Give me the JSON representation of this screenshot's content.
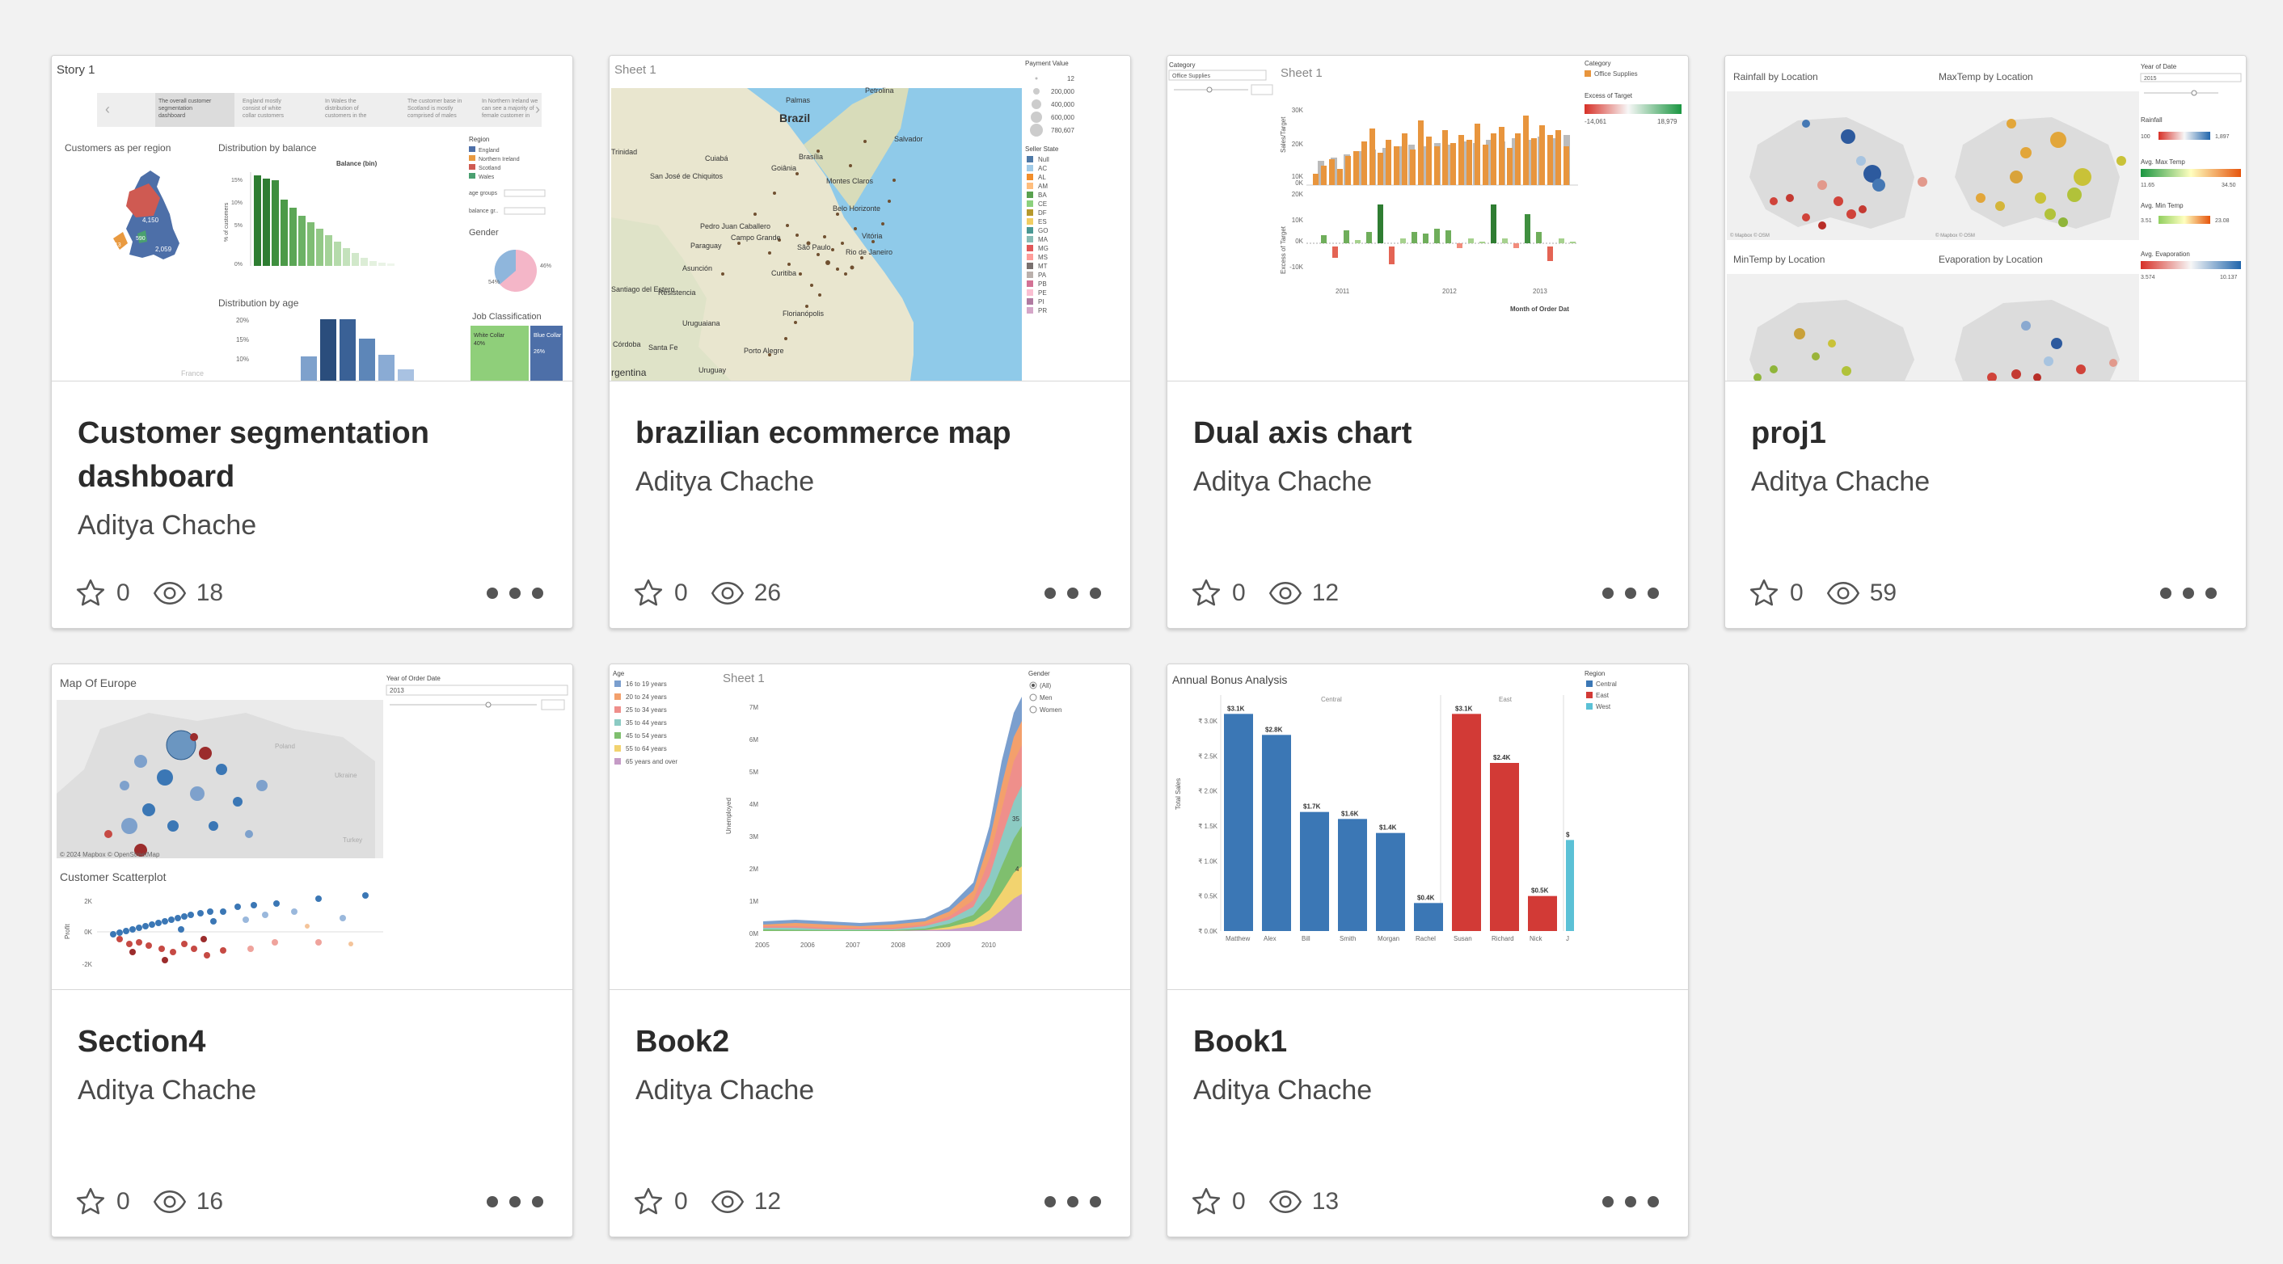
{
  "cards": [
    {
      "title": "Customer segmentation dashboard",
      "author": "Aditya Chache",
      "favorites": "0",
      "views": "18",
      "thumb": {
        "tab": "Story 1",
        "story_points": [
          "The overall customer segmentation dashboard",
          "England mostly consist of white collar customers",
          "In Wales the distribution of customers in the",
          "The customer base in Scotland is mostly comprised of males",
          "In Northern Ireland we can see a majority of female customer in"
        ],
        "panel1": "Customers as per region",
        "panel2": "Distribution by balance",
        "chart_title": "Balance (bin)",
        "panel3": "Distribution by age",
        "legend_title": "Region",
        "legend": [
          "England",
          "Northern Ireland",
          "Scotland",
          "Wales"
        ],
        "filter1": "age groups",
        "filter2": "balance gr..",
        "gender": "Gender",
        "job": "Job Classification",
        "white": "White Collar",
        "white_pct": "40%",
        "blue": "Blue Collar",
        "blue_pct": "26%",
        "france": "France",
        "pie_left": "54%",
        "pie_right": "46%",
        "ylab": "% of customers",
        "map_labels": [
          "4,150",
          "2,059",
          "413",
          "590"
        ],
        "y_ticks": [
          "15%",
          "10%",
          "5%",
          "0%"
        ],
        "age_ticks": [
          "20%",
          "15%",
          "10%"
        ]
      }
    },
    {
      "title": "brazilian ecommerce map",
      "author": "Aditya Chache",
      "favorites": "0",
      "views": "26",
      "thumb": {
        "sheet": "Sheet 1",
        "pay_title": "Payment Value",
        "pay": [
          "12",
          "200,000",
          "400,000",
          "600,000",
          "780,607"
        ],
        "state_title": "Seller State",
        "states": [
          "Null",
          "AC",
          "AL",
          "AM",
          "BA",
          "CE",
          "DF",
          "ES",
          "GO",
          "MA",
          "MG",
          "MS",
          "MT",
          "PA",
          "PB",
          "PE",
          "PI",
          "PR"
        ],
        "places": [
          "Brazil",
          "Palmas",
          "Petrolina",
          "Salvador",
          "Cuiabá",
          "Goiânia",
          "Brasília",
          "Montes Claros",
          "Belo Horizonte",
          "Pedro Juan Caballero",
          "Paraguay",
          "Asunción",
          "Curitiba",
          "Resistencia",
          "Santiago del Estero",
          "Uruguaiana",
          "Porto Alegre",
          "Córdoba",
          "Santa Fe",
          "Uruguay",
          "rgentina",
          "Trinidad",
          "San José de Chiquitos",
          "Campo Grande",
          "São Paulo",
          "Rio de Janeiro",
          "Florianópolis",
          "Vitória"
        ]
      }
    },
    {
      "title": "Dual axis chart",
      "author": "Aditya Chache",
      "favorites": "0",
      "views": "12",
      "thumb": {
        "sheet": "Sheet 1",
        "filter_title": "Category",
        "filter_value": "Office Supplies",
        "legend_title": "Category",
        "legend_item": "Office Supplies",
        "excess_title": "Excess of Target",
        "excess_min": "-14,061",
        "excess_max": "18,979",
        "y1": "Sales/Target",
        "y2": "Excess of Target",
        "x_title": "Month of Order Dat",
        "years": [
          "2011",
          "2012",
          "2013"
        ],
        "y1_ticks": [
          "30K",
          "20K",
          "10K",
          "0K"
        ],
        "y2_ticks": [
          "20K",
          "10K",
          "0K",
          "-10K"
        ]
      }
    },
    {
      "title": "proj1",
      "author": "Aditya Chache",
      "favorites": "0",
      "views": "59",
      "thumb": {
        "titles": [
          "Rainfall by Location",
          "MaxTemp by Location",
          "MinTemp by Location",
          "Evaporation by Location"
        ],
        "year_title": "Year of Date",
        "year": "2015",
        "rain": "Rainfall",
        "rain_min": "100",
        "rain_max": "1,897",
        "maxt": "Avg. Max Temp",
        "maxt_min": "11.65",
        "maxt_max": "34.50",
        "mint": "Avg. Min Temp",
        "mint_min": "3.51",
        "mint_max": "23.08",
        "evap": "Avg. Evaporation",
        "evap_min": "3.574",
        "evap_max": "10.137",
        "credit": "© Mapbox © OSM"
      }
    },
    {
      "title": "Section4",
      "author": "Aditya Chache",
      "favorites": "0",
      "views": "16",
      "thumb": {
        "map_title": "Map Of Europe",
        "year_title": "Year of Order Date",
        "year": "2013",
        "credit": "© 2024 Mapbox © OpenStreetMap",
        "scatter_title": "Customer Scatterplot",
        "ylab": "Profit",
        "ticks": [
          "2K",
          "0K",
          "-2K"
        ],
        "countries": [
          "Poland",
          "Ukraine",
          "Turkey"
        ]
      }
    },
    {
      "title": "Book2",
      "author": "Aditya Chache",
      "favorites": "0",
      "views": "12",
      "thumb": {
        "sheet": "Sheet 1",
        "age_title": "Age",
        "ages": [
          "16 to 19 years",
          "20 to 24 years",
          "25 to 34 years",
          "35 to 44 years",
          "45 to 54 years",
          "55 to 64 years",
          "65 years and over"
        ],
        "gender_title": "Gender",
        "genders": [
          "(All)",
          "Men",
          "Women"
        ],
        "ylab": "Unemployed",
        "yticks": [
          "7M",
          "6M",
          "5M",
          "4M",
          "3M",
          "2M",
          "1M",
          "0M"
        ],
        "xticks": [
          "2005",
          "2006",
          "2007",
          "2008",
          "2009",
          "2010"
        ],
        "labels": [
          "35",
          "4"
        ]
      }
    },
    {
      "title": "Book1",
      "author": "Aditya Chache",
      "favorites": "0",
      "views": "13",
      "thumb": {
        "title": "Annual Bonus Analysis",
        "region_title": "Region",
        "regions": [
          "Central",
          "East",
          "West"
        ],
        "groups": [
          "Central",
          "East"
        ],
        "ylab": "Total Sales",
        "yticks": [
          "₹ 3.0K",
          "₹ 2.5K",
          "₹ 2.0K",
          "₹ 1.5K",
          "₹ 1.0K",
          "₹ 0.5K",
          "₹ 0.0K"
        ],
        "chart_data": {
          "type": "bar",
          "categories": [
            "Matthew",
            "Alex",
            "Bill",
            "Smith",
            "Morgan",
            "Rachel",
            "Susan",
            "Richard",
            "Nick",
            "J"
          ],
          "values": [
            3.1,
            2.8,
            1.7,
            1.6,
            1.4,
            0.4,
            3.1,
            2.4,
            0.5,
            1.3
          ],
          "labels": [
            "$3.1K",
            "$2.8K",
            "$1.7K",
            "$1.6K",
            "$1.4K",
            "$0.4K",
            "$3.1K",
            "$2.4K",
            "$0.5K",
            "$"
          ],
          "colors": [
            "#3b77b5",
            "#3b77b5",
            "#3b77b5",
            "#3b77b5",
            "#3b77b5",
            "#3b77b5",
            "#d23a36",
            "#d23a36",
            "#d23a36",
            "#5bc1d6"
          ]
        }
      }
    }
  ]
}
